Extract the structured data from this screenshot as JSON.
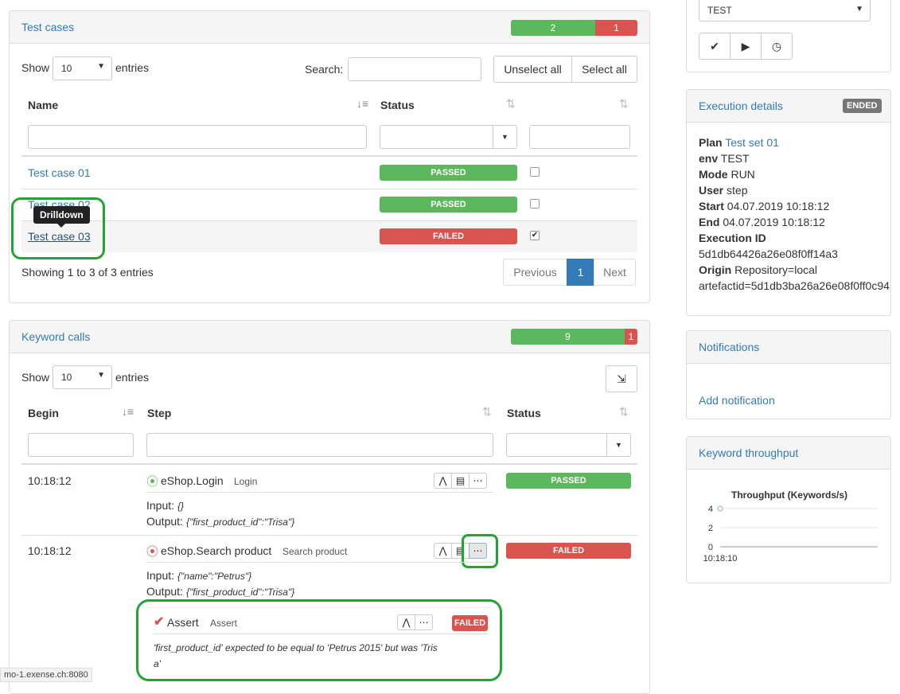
{
  "test_cases": {
    "title": "Test cases",
    "progress": {
      "passed": "2",
      "failed": "1"
    },
    "show_label": "Show",
    "entries_label": "entries",
    "page_size": "10",
    "search_label": "Search:",
    "unselect_all": "Unselect all",
    "select_all": "Select all",
    "columns": {
      "name": "Name",
      "status": "Status"
    },
    "rows": [
      {
        "name": "Test case 01",
        "status": "PASSED",
        "checked": false
      },
      {
        "name": "Test case 02",
        "status": "PASSED",
        "checked": false
      },
      {
        "name": "Test case 03",
        "status": "FAILED",
        "checked": true
      }
    ],
    "tooltip": "Drilldown",
    "showing": "Showing 1 to 3 of 3 entries",
    "pager": {
      "previous": "Previous",
      "current": "1",
      "next": "Next"
    }
  },
  "keyword_calls": {
    "title": "Keyword calls",
    "progress": {
      "passed": "9",
      "failed": "1"
    },
    "show_label": "Show",
    "entries_label": "entries",
    "page_size": "10",
    "columns": {
      "begin": "Begin",
      "step": "Step",
      "status": "Status"
    },
    "rows": [
      {
        "time": "10:18:12",
        "name": "eShop.Login",
        "desc": "Login",
        "input_label": "Input:",
        "input": "{}",
        "output_label": "Output:",
        "output": "{\"first_product_id\":\"Trisa\"}",
        "status": "PASSED"
      },
      {
        "time": "10:18:12",
        "name": "eShop.Search product",
        "desc": "Search product",
        "input_label": "Input:",
        "input": "{\"name\":\"Petrus\"}",
        "output_label": "Output:",
        "output": "{\"first_product_id\":\"Trisa\"}",
        "status": "FAILED"
      }
    ],
    "assert": {
      "name": "Assert",
      "desc": "Assert",
      "status": "FAILED",
      "message_line1": "'first_product_id' expected to be equal to 'Petrus 2015' but was 'Tris",
      "message_line2": "a'"
    }
  },
  "top_right": {
    "env_select": "TEST",
    "buttons": [
      "check-icon",
      "play-icon",
      "clock-icon"
    ]
  },
  "execution_details": {
    "title": "Execution details",
    "badge": "ENDED",
    "plan_label": "Plan",
    "plan_value": "Test set 01",
    "env_label": "env",
    "env_value": "TEST",
    "mode_label": "Mode",
    "mode_value": "RUN",
    "user_label": "User",
    "user_value": "step",
    "start_label": "Start",
    "start_value": "04.07.2019 10:18:12",
    "end_label": "End",
    "end_value": "04.07.2019 10:18:12",
    "exec_id_label": "Execution ID",
    "exec_id_value": "5d1db64426a26e08f0ff14a3",
    "origin_label": "Origin",
    "origin_value": "Repository=local",
    "origin_value2": "artefactid=5d1db3ba26a26e08f0ff0c94"
  },
  "notifications": {
    "title": "Notifications",
    "add": "Add notification"
  },
  "throughput": {
    "title": "Keyword throughput",
    "chart_data": {
      "type": "line",
      "title": "Throughput (Keywords/s)",
      "x": [
        "10:18:10"
      ],
      "y": [
        4
      ],
      "yticks": [
        0,
        2,
        4
      ],
      "ylim": [
        0,
        4
      ]
    }
  },
  "status_url": "mo-1.exense.ch:8080"
}
